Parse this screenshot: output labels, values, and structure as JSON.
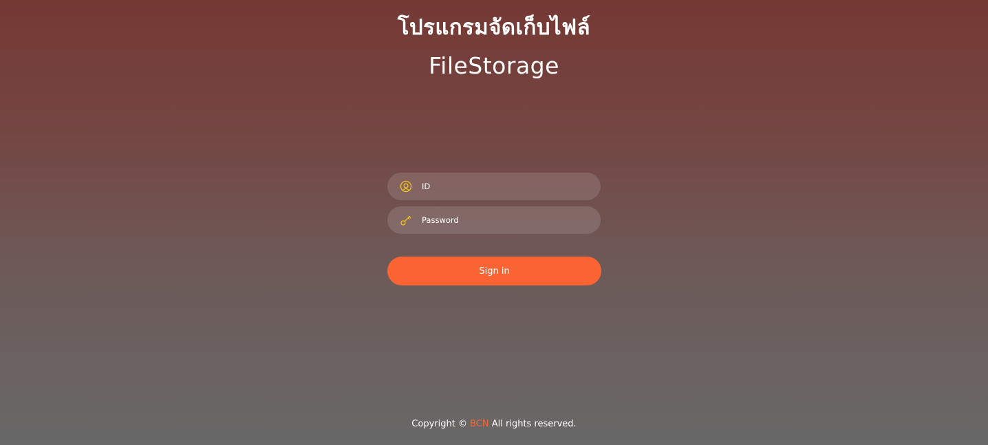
{
  "header": {
    "thai_title": "โปรแกรมจัดเก็บไฟล์",
    "app_title": "FileStorage"
  },
  "login_form": {
    "id_field": {
      "placeholder": "ID",
      "value": "",
      "icon": "user-circle-icon"
    },
    "password_field": {
      "placeholder": "Password",
      "value": "",
      "icon": "key-icon"
    },
    "sign_in_label": "Sign in"
  },
  "footer": {
    "prefix": "Copyright ©",
    "brand": "BCN",
    "suffix": "All rights reserved."
  },
  "colors": {
    "accent": "#f96432",
    "icon": "#f5c518",
    "background_top": "#753934",
    "background_bottom": "#686868"
  }
}
